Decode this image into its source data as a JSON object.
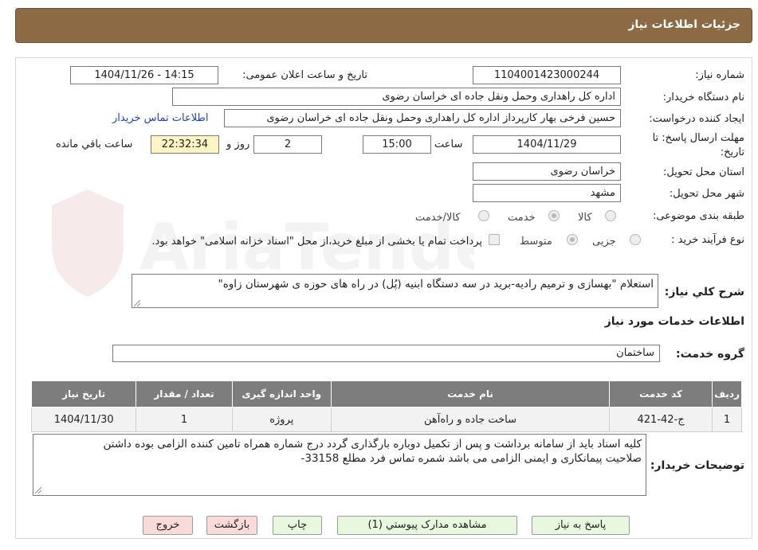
{
  "header": {
    "title": "جزئیات اطلاعات نیاز"
  },
  "fields": {
    "need_number_label": "شماره نیاز:",
    "need_number": "1104001423000244",
    "announce_label": "تاریخ و ساعت اعلان عمومی:",
    "announce_value": "1404/11/26 - 14:15",
    "buyer_org_label": "نام دستگاه خریدار:",
    "buyer_org": "اداره کل راهداری وحمل ونقل جاده ای خراسان رضوی",
    "creator_label": "ایجاد کننده درخواست:",
    "creator": "حسین فرخی بهار کارپرداز اداره کل راهداری وحمل ونقل جاده ای خراسان رضوی",
    "contact_link": "اطلاعات تماس خریدار",
    "deadline_label_1": "مهلت ارسال پاسخ: تا",
    "deadline_label_2": "تاریخ:",
    "deadline_date": "1404/11/29",
    "time_label": "ساعت",
    "deadline_time": "15:00",
    "days": "2",
    "days_label": "روز و",
    "remaining_time": "22:32:34",
    "remaining_label": "ساعت باقي مانده",
    "province_label": "استان محل تحویل:",
    "province": "خراسان رضوی",
    "city_label": "شهر محل تحویل:",
    "city": "مشهد",
    "category_label": "طبقه بندی موضوعی:",
    "category_options": [
      "کالا",
      "خدمت",
      "کالا/خدمت"
    ],
    "process_label": "نوع فرآیند خرید :",
    "process_options": [
      "جزیی",
      "متوسط"
    ],
    "payment_note": "پرداخت تمام یا بخشی از مبلغ خرید،از محل \"اسناد خزانه اسلامی\" خواهد بود."
  },
  "description": {
    "label": "شرح کلي نياز:",
    "value": "استعلام \"بهسازی و ترمیم رادیه-برید در سه دستگاه ابنیه (پُل) در راه های حوزه ی شهرستان زاوه\""
  },
  "services": {
    "section_title": "اطلاعات خدمات مورد نياز",
    "group_label": "گروه خدمت:",
    "group_value": "ساختمان",
    "columns": [
      "رديف",
      "کد خدمت",
      "نام خدمت",
      "واحد اندازه گیری",
      "تعداد / مقدار",
      "تاريخ نياز"
    ],
    "rows": [
      {
        "row": "1",
        "code": "ج-42-421",
        "name": "ساخت جاده و راه‌آهن",
        "unit": "پروژه",
        "qty": "1",
        "date": "1404/11/30"
      }
    ]
  },
  "buyer_notes": {
    "label": "توضیحات خریدار:",
    "line1": "کلیه اسناد باید از سامانه برداشت و پس از تکمیل دوباره بارگذاری گردد درج شماره همراه تامین کننده الزامی بوده داشتن",
    "line2": "صلاحیت پیمانکاری و ایمنی الزامی می باشد  شمره تماس فرد مطلع  33158-"
  },
  "buttons": {
    "reply": "پاسخ به نياز",
    "attachments": "مشاهده مدارک پيوستي (1)",
    "print": "چاپ",
    "back": "بازگشت",
    "exit": "خروج"
  },
  "watermark": {
    "text": "AriaTender.neT"
  },
  "colors": {
    "header_bg": "#8b6a44",
    "table_header": "#7d7d7d",
    "link": "#1a44c7",
    "timer_bg": "#fff5c4"
  }
}
